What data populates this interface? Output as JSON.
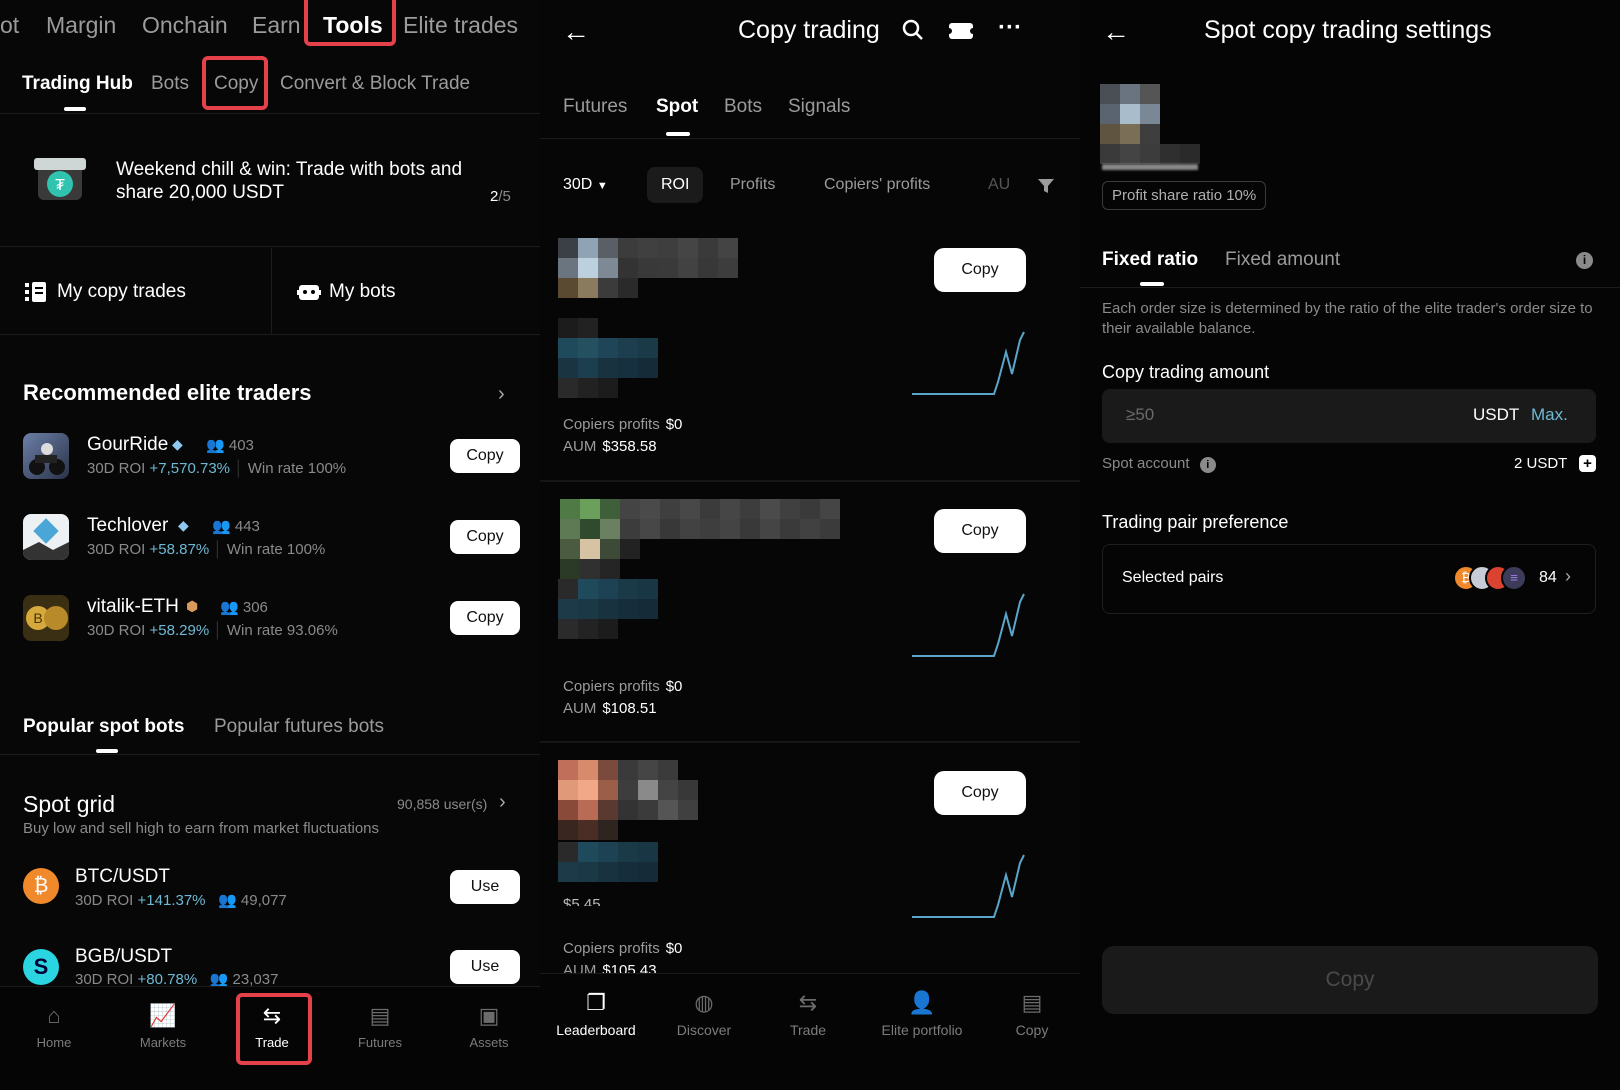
{
  "panel1": {
    "top_tabs": [
      "ot",
      "Margin",
      "Onchain",
      "Earn",
      "Tools",
      "Elite trades"
    ],
    "sub_tabs": [
      "Trading Hub",
      "Bots",
      "Copy",
      "Convert & Block Trade"
    ],
    "banner": {
      "text": "Weekend chill & win: Trade with bots and share 20,000 USDT",
      "page": "2",
      "page_total": "/5"
    },
    "quick": {
      "copy_trades": "My copy trades",
      "bots": "My bots"
    },
    "recommended": {
      "title": "Recommended elite traders",
      "traders": [
        {
          "name": "GourRide",
          "followers": "403",
          "roi_label": "30D ROI",
          "roi": "+7,570.73%",
          "win": "Win rate 100%",
          "button": "Copy"
        },
        {
          "name": "Techlover",
          "followers": "443",
          "roi_label": "30D ROI",
          "roi": "+58.87%",
          "win": "Win rate 100%",
          "button": "Copy"
        },
        {
          "name": "vitalik-ETH",
          "followers": "306",
          "roi_label": "30D ROI",
          "roi": "+58.29%",
          "win": "Win rate 93.06%",
          "button": "Copy"
        }
      ]
    },
    "bots_tabs": [
      "Popular spot bots",
      "Popular futures bots"
    ],
    "spot_grid": {
      "title": "Spot grid",
      "users": "90,858 user(s)",
      "desc": "Buy low and sell high to earn from market fluctuations",
      "pairs": [
        {
          "pair": "BTC/USDT",
          "roi_label": "30D ROI",
          "roi": "+141.37%",
          "users": "49,077",
          "button": "Use"
        },
        {
          "pair": "BGB/USDT",
          "roi_label": "30D ROI",
          "roi": "+80.78%",
          "users": "23,037",
          "button": "Use"
        }
      ]
    },
    "nav": [
      "Home",
      "Markets",
      "Trade",
      "Futures",
      "Assets"
    ]
  },
  "panel2": {
    "title": "Copy trading",
    "tabs": [
      "Futures",
      "Spot",
      "Bots",
      "Signals"
    ],
    "period": "30D",
    "chips": [
      "ROI",
      "Profits",
      "Copiers' profits",
      "AU"
    ],
    "cards": [
      {
        "copiers_label": "Copiers profits",
        "copiers_value": "$0",
        "aum_label": "AUM",
        "aum_value": "$358.58",
        "button": "Copy"
      },
      {
        "copiers_label": "Copiers profits",
        "copiers_value": "$0",
        "aum_label": "AUM",
        "aum_value": "$108.51",
        "button": "Copy"
      },
      {
        "copiers_label": "Copiers profits",
        "copiers_value": "$0",
        "aum_label": "AUM",
        "aum_value": "$105.43",
        "button": "Copy",
        "extra": "$5.45"
      }
    ],
    "nav": [
      "Leaderboard",
      "Discover",
      "Trade",
      "Elite portfolio",
      "Copy"
    ]
  },
  "panel3": {
    "title": "Spot copy trading settings",
    "profit_share": "Profit share ratio 10%",
    "tabs": [
      "Fixed ratio",
      "Fixed amount"
    ],
    "description": "Each order size is determined by the ratio of the elite trader's order size to their available balance.",
    "amount_label": "Copy trading amount",
    "amount_placeholder": "≥50",
    "currency": "USDT",
    "max": "Max.",
    "spot_account": "Spot account",
    "spot_balance": "2 USDT",
    "pref_label": "Trading pair preference",
    "selected_pairs": "Selected pairs",
    "pair_count": "84",
    "copy_button": "Copy"
  },
  "colors": {
    "accent_roi": "#6fb9d4",
    "highlight_red": "#e5414a",
    "chart_line": "#5aa5c9"
  }
}
